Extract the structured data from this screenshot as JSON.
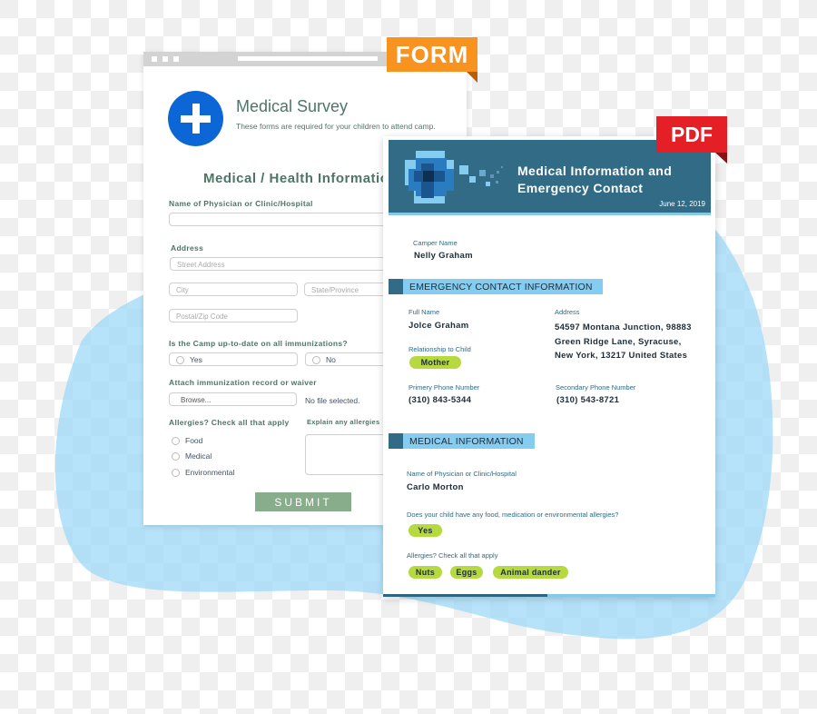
{
  "colors": {
    "form_accent": "#f7931e",
    "pdf_accent": "#e42026",
    "form_text": "#4e7566",
    "submit_bg": "#88ad8b",
    "pdf_header_bg": "#316b86",
    "section_bg": "#84cdf0",
    "pill_bg": "#b6d93f",
    "logo_blue": "#0d66d6"
  },
  "form_tag": "FORM",
  "pdf_tag": "PDF",
  "form": {
    "logo_icon": "medical-cross-icon",
    "title": "Medical Survey",
    "subtitle": "These forms are required for your children to attend camp.",
    "heading": "Medical / Health Information",
    "physician_label": "Name of Physician or Clinic/Hospital",
    "physician_value": "",
    "address_label": "Address",
    "street_placeholder": "Street Address",
    "city_placeholder": "City",
    "state_placeholder": "State/Province",
    "zip_placeholder": "Postal/Zip Code",
    "immunization_question": "Is the Camp up-to-date on all immunizations?",
    "immunization_options": [
      "Yes",
      "No"
    ],
    "attach_label": "Attach immunization record or waiver",
    "browse_label": "Browse...",
    "no_file": "No file selected.",
    "allergies_label": "Allergies? Check all that apply",
    "allergy_options": [
      "Food",
      "Medical",
      "Environmental"
    ],
    "explain_label": "Explain any allergies",
    "explain_value": "",
    "submit_label": "SUBMIT"
  },
  "pdf": {
    "title_line1": "Medical Information and",
    "title_line2": "Emergency Contact",
    "date": "June 12, 2019",
    "camper_name_label": "Camper Name",
    "camper_name": "Nelly Graham",
    "emergency_section": "EMERGENCY CONTACT INFORMATION",
    "full_name_label": "Full Name",
    "full_name": "Jolce Graham",
    "relationship_label": "Relationship to Child",
    "relationship": "Mother",
    "address_label": "Address",
    "address_lines": [
      "54597 Montana Junction, 98883",
      "Green Ridge Lane, Syracuse,",
      "New York, 13217 United States"
    ],
    "primary_phone_label": "Primery Phone Number",
    "primary_phone": "(310) 843-5344",
    "secondary_phone_label": "Secondary Phone Number",
    "secondary_phone": "(310) 543-8721",
    "medical_section": "MEDICAL INFORMATION",
    "physician_label": "Name of Physician or Clinic/Hospital",
    "physician": "Carlo Morton",
    "allergy_question": "Does your child have any food, medication or environmental allergies?",
    "allergy_answer": "Yes",
    "allergies_label": "Allergies? Check all that apply",
    "allergies": [
      "Nuts",
      "Eggs",
      "Animal dander"
    ]
  }
}
